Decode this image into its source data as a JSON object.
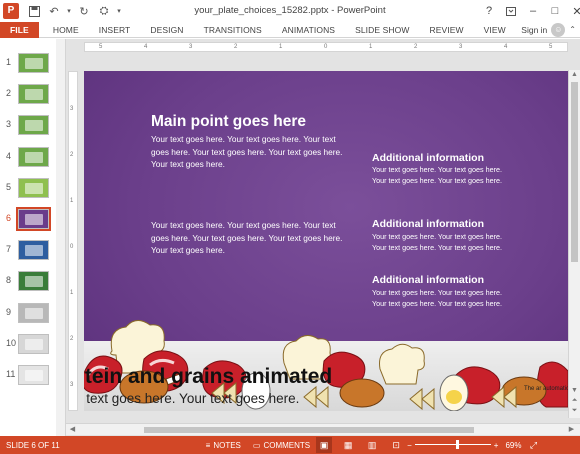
{
  "window": {
    "title": "your_plate_choices_15282.pptx - PowerPoint",
    "help_label": "?",
    "minimize_label": "–",
    "restore_label": "□",
    "close_label": "✕"
  },
  "ribbon": {
    "tabs": [
      "FILE",
      "HOME",
      "INSERT",
      "DESIGN",
      "TRANSITIONS",
      "ANIMATIONS",
      "SLIDE SHOW",
      "REVIEW",
      "VIEW"
    ],
    "signin_label": "Sign in"
  },
  "rulers": {
    "horizontal_ticks": [
      "5",
      "4",
      "3",
      "2",
      "1",
      "0",
      "1",
      "2",
      "3",
      "4",
      "5"
    ],
    "vertical_ticks": [
      "3",
      "2",
      "1",
      "0",
      "1",
      "2",
      "3"
    ]
  },
  "thumbnails": {
    "numbers": [
      "1",
      "2",
      "3",
      "4",
      "5",
      "6",
      "7",
      "8",
      "9",
      "10",
      "11"
    ],
    "selected_index": 6,
    "colors": [
      "#6ea84a",
      "#6ea84a",
      "#6ea84a",
      "#6ea84a",
      "#8fc04f",
      "#6a3c8b",
      "#2e5ea0",
      "#3a7d3a",
      "#b8b8b8",
      "#d7d7d7",
      "#e4e4e4"
    ]
  },
  "slide": {
    "main_heading": "Main point goes here",
    "body_1": "Your text goes here. Your text goes here. Your text goes here. Your text goes here. Your text goes here. Your text goes here.",
    "body_2": "Your text goes here. Your text goes here. Your text goes here. Your text goes here. Your text goes here. Your text goes here.",
    "additional": [
      {
        "heading": "Additional information",
        "text": "Your text goes here. Your text goes here. Your text goes here. Your text goes here."
      },
      {
        "heading": "Additional information",
        "text": "Your text goes here. Your text goes here. Your text goes here. Your text goes here."
      },
      {
        "heading": "Additional information",
        "text": "Your text goes here. Your text goes here. Your text goes here. Your text goes here."
      }
    ],
    "bottom_title": "otein and grains animated",
    "bottom_subtitle": "r text goes here. Your text goes here.",
    "corner_note": "The ar automaticall",
    "colors": {
      "background": "#6a3c8b",
      "band": "#e6e6e6"
    }
  },
  "status": {
    "slide_info": "SLIDE 6 OF 11",
    "notes_label": "NOTES",
    "comments_label": "COMMENTS",
    "zoom_percent": "69%",
    "zoom_minus": "−",
    "zoom_plus": "+",
    "zoom_fraction": 0.56,
    "accent": "#d24726"
  }
}
